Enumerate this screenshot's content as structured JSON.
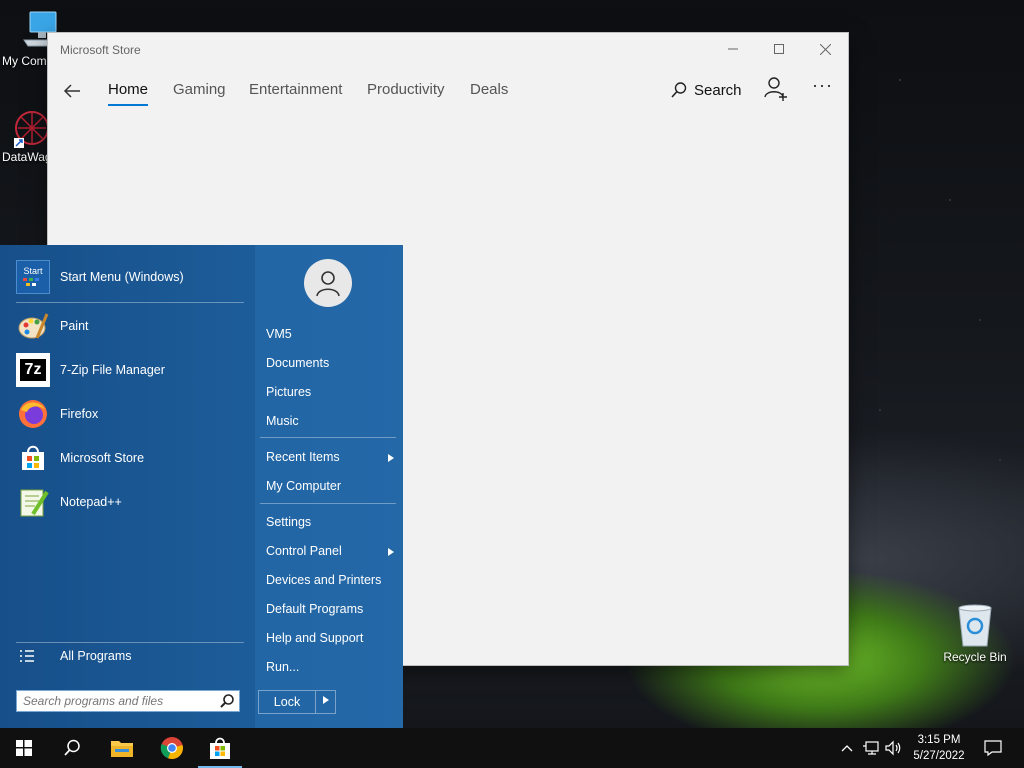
{
  "desktop": {
    "icons": [
      {
        "label": "My Com"
      },
      {
        "label": "DataWag"
      },
      {
        "label": "Recycle Bin"
      }
    ]
  },
  "store_window": {
    "title": "Microsoft Store",
    "tabs": [
      "Home",
      "Gaming",
      "Entertainment",
      "Productivity",
      "Deals"
    ],
    "active_tab": "Home",
    "search_label": "Search",
    "more_label": "···",
    "accent": "#0078d4"
  },
  "start_menu": {
    "pinned": [
      {
        "label": "Start Menu (Windows)",
        "icon": "start-menu-icon"
      },
      {
        "label": "Paint",
        "icon": "paint-icon"
      },
      {
        "label": "7-Zip File Manager",
        "icon": "7zip-icon"
      },
      {
        "label": "Firefox",
        "icon": "firefox-icon"
      },
      {
        "label": "Microsoft Store",
        "icon": "store-icon"
      },
      {
        "label": "Notepad++",
        "icon": "notepadpp-icon"
      }
    ],
    "start_icon_text": "Start",
    "sevenzip_icon_text": "7z",
    "all_programs": "All Programs",
    "search_placeholder": "Search programs and files",
    "right_items": [
      {
        "label": "VM5"
      },
      {
        "label": "Documents"
      },
      {
        "label": "Pictures"
      },
      {
        "label": "Music"
      },
      {
        "label": "Recent Items"
      },
      {
        "label": "My Computer"
      },
      {
        "label": "Settings"
      },
      {
        "label": "Control Panel"
      },
      {
        "label": "Devices and Printers"
      },
      {
        "label": "Default Programs"
      },
      {
        "label": "Help and Support"
      },
      {
        "label": "Run..."
      }
    ],
    "lock_label": "Lock",
    "bg_color": "#1c5c98"
  },
  "taskbar": {
    "time": "3:15 PM",
    "date": "5/27/2022"
  }
}
